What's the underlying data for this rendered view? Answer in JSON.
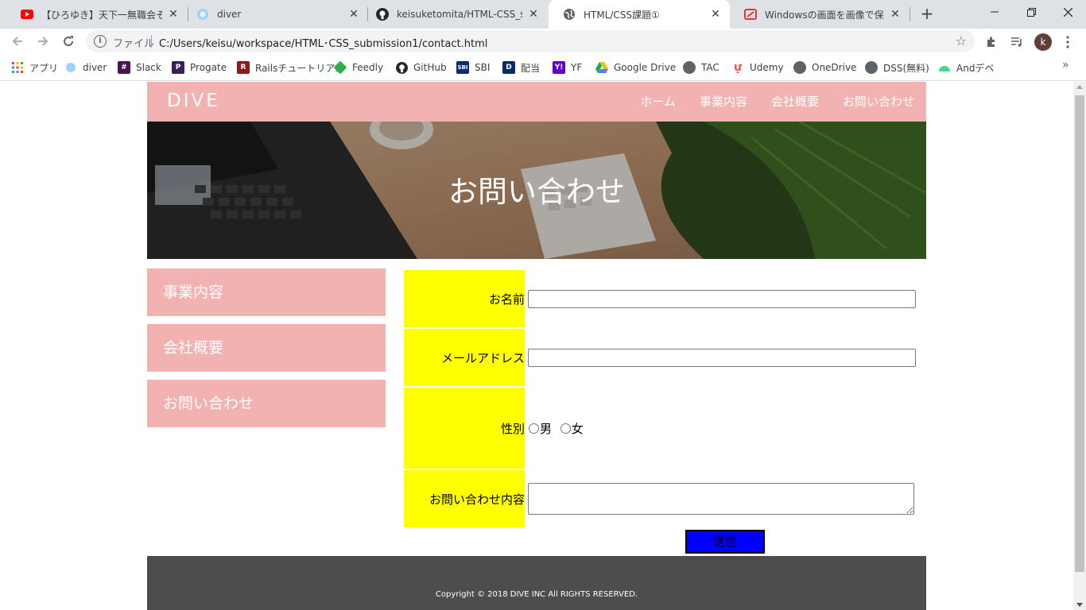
{
  "browser": {
    "tabs": [
      {
        "title": "【ひろゆき】天下一無職会その後、",
        "favicon": "youtube-icon",
        "active": false
      },
      {
        "title": "diver",
        "favicon": "diver-icon",
        "active": false
      },
      {
        "title": "keisuketomita/HTML-CSS_subr",
        "favicon": "github-icon",
        "active": false
      },
      {
        "title": "HTML/CSS課題①",
        "favicon": "globe-icon",
        "active": true
      },
      {
        "title": "Windowsの画面を画像で保存す",
        "favicon": "image-site-icon",
        "active": false
      }
    ],
    "address": {
      "scheme_label": "ファイル",
      "url": "C:/Users/keisu/workspace/HTML･CSS_submission1/contact.html"
    },
    "profile_initial": "k",
    "bookmarks": [
      {
        "label": "アプリ",
        "icon": "apps-grid-icon"
      },
      {
        "label": "diver",
        "icon": "diver-icon"
      },
      {
        "label": "Slack",
        "icon": "slack-icon"
      },
      {
        "label": "Progate",
        "icon": "progate-icon"
      },
      {
        "label": "Railsチュートリアル",
        "icon": "rails-icon"
      },
      {
        "label": "Feedly",
        "icon": "feedly-icon"
      },
      {
        "label": "GitHub",
        "icon": "github-icon"
      },
      {
        "label": "SBI",
        "icon": "sbi-icon"
      },
      {
        "label": "配当",
        "icon": "d-icon"
      },
      {
        "label": "YF",
        "icon": "yahoo-finance-icon"
      },
      {
        "label": "Google Drive",
        "icon": "google-drive-icon"
      },
      {
        "label": "TAC",
        "icon": "globe-icon"
      },
      {
        "label": "Udemy",
        "icon": "udemy-icon"
      },
      {
        "label": "OneDrive",
        "icon": "globe-icon"
      },
      {
        "label": "DSS(無料)",
        "icon": "globe-icon"
      },
      {
        "label": "Andデベ",
        "icon": "android-icon"
      }
    ]
  },
  "site": {
    "logo": "DIVE",
    "nav": [
      "ホーム",
      "事業内容",
      "会社概要",
      "お問い合わせ"
    ],
    "hero_title": "お問い合わせ",
    "side_menu": [
      "事業内容",
      "会社概要",
      "お問い合わせ"
    ],
    "form": {
      "name_label": "お名前",
      "email_label": "メールアドレス",
      "gender_label": "性別",
      "gender_options": [
        "男",
        "女"
      ],
      "message_label": "お問い合わせ内容",
      "submit_label": "送信"
    },
    "footer": {
      "copyright": "Copyright © 2018 DIVE INC All RIGHTS RESERVED."
    },
    "colors": {
      "header_pink": "#f3b2b2",
      "label_yellow": "#ffff00",
      "submit_blue": "#0000ff",
      "footer_gray": "#4d4d4d"
    }
  }
}
